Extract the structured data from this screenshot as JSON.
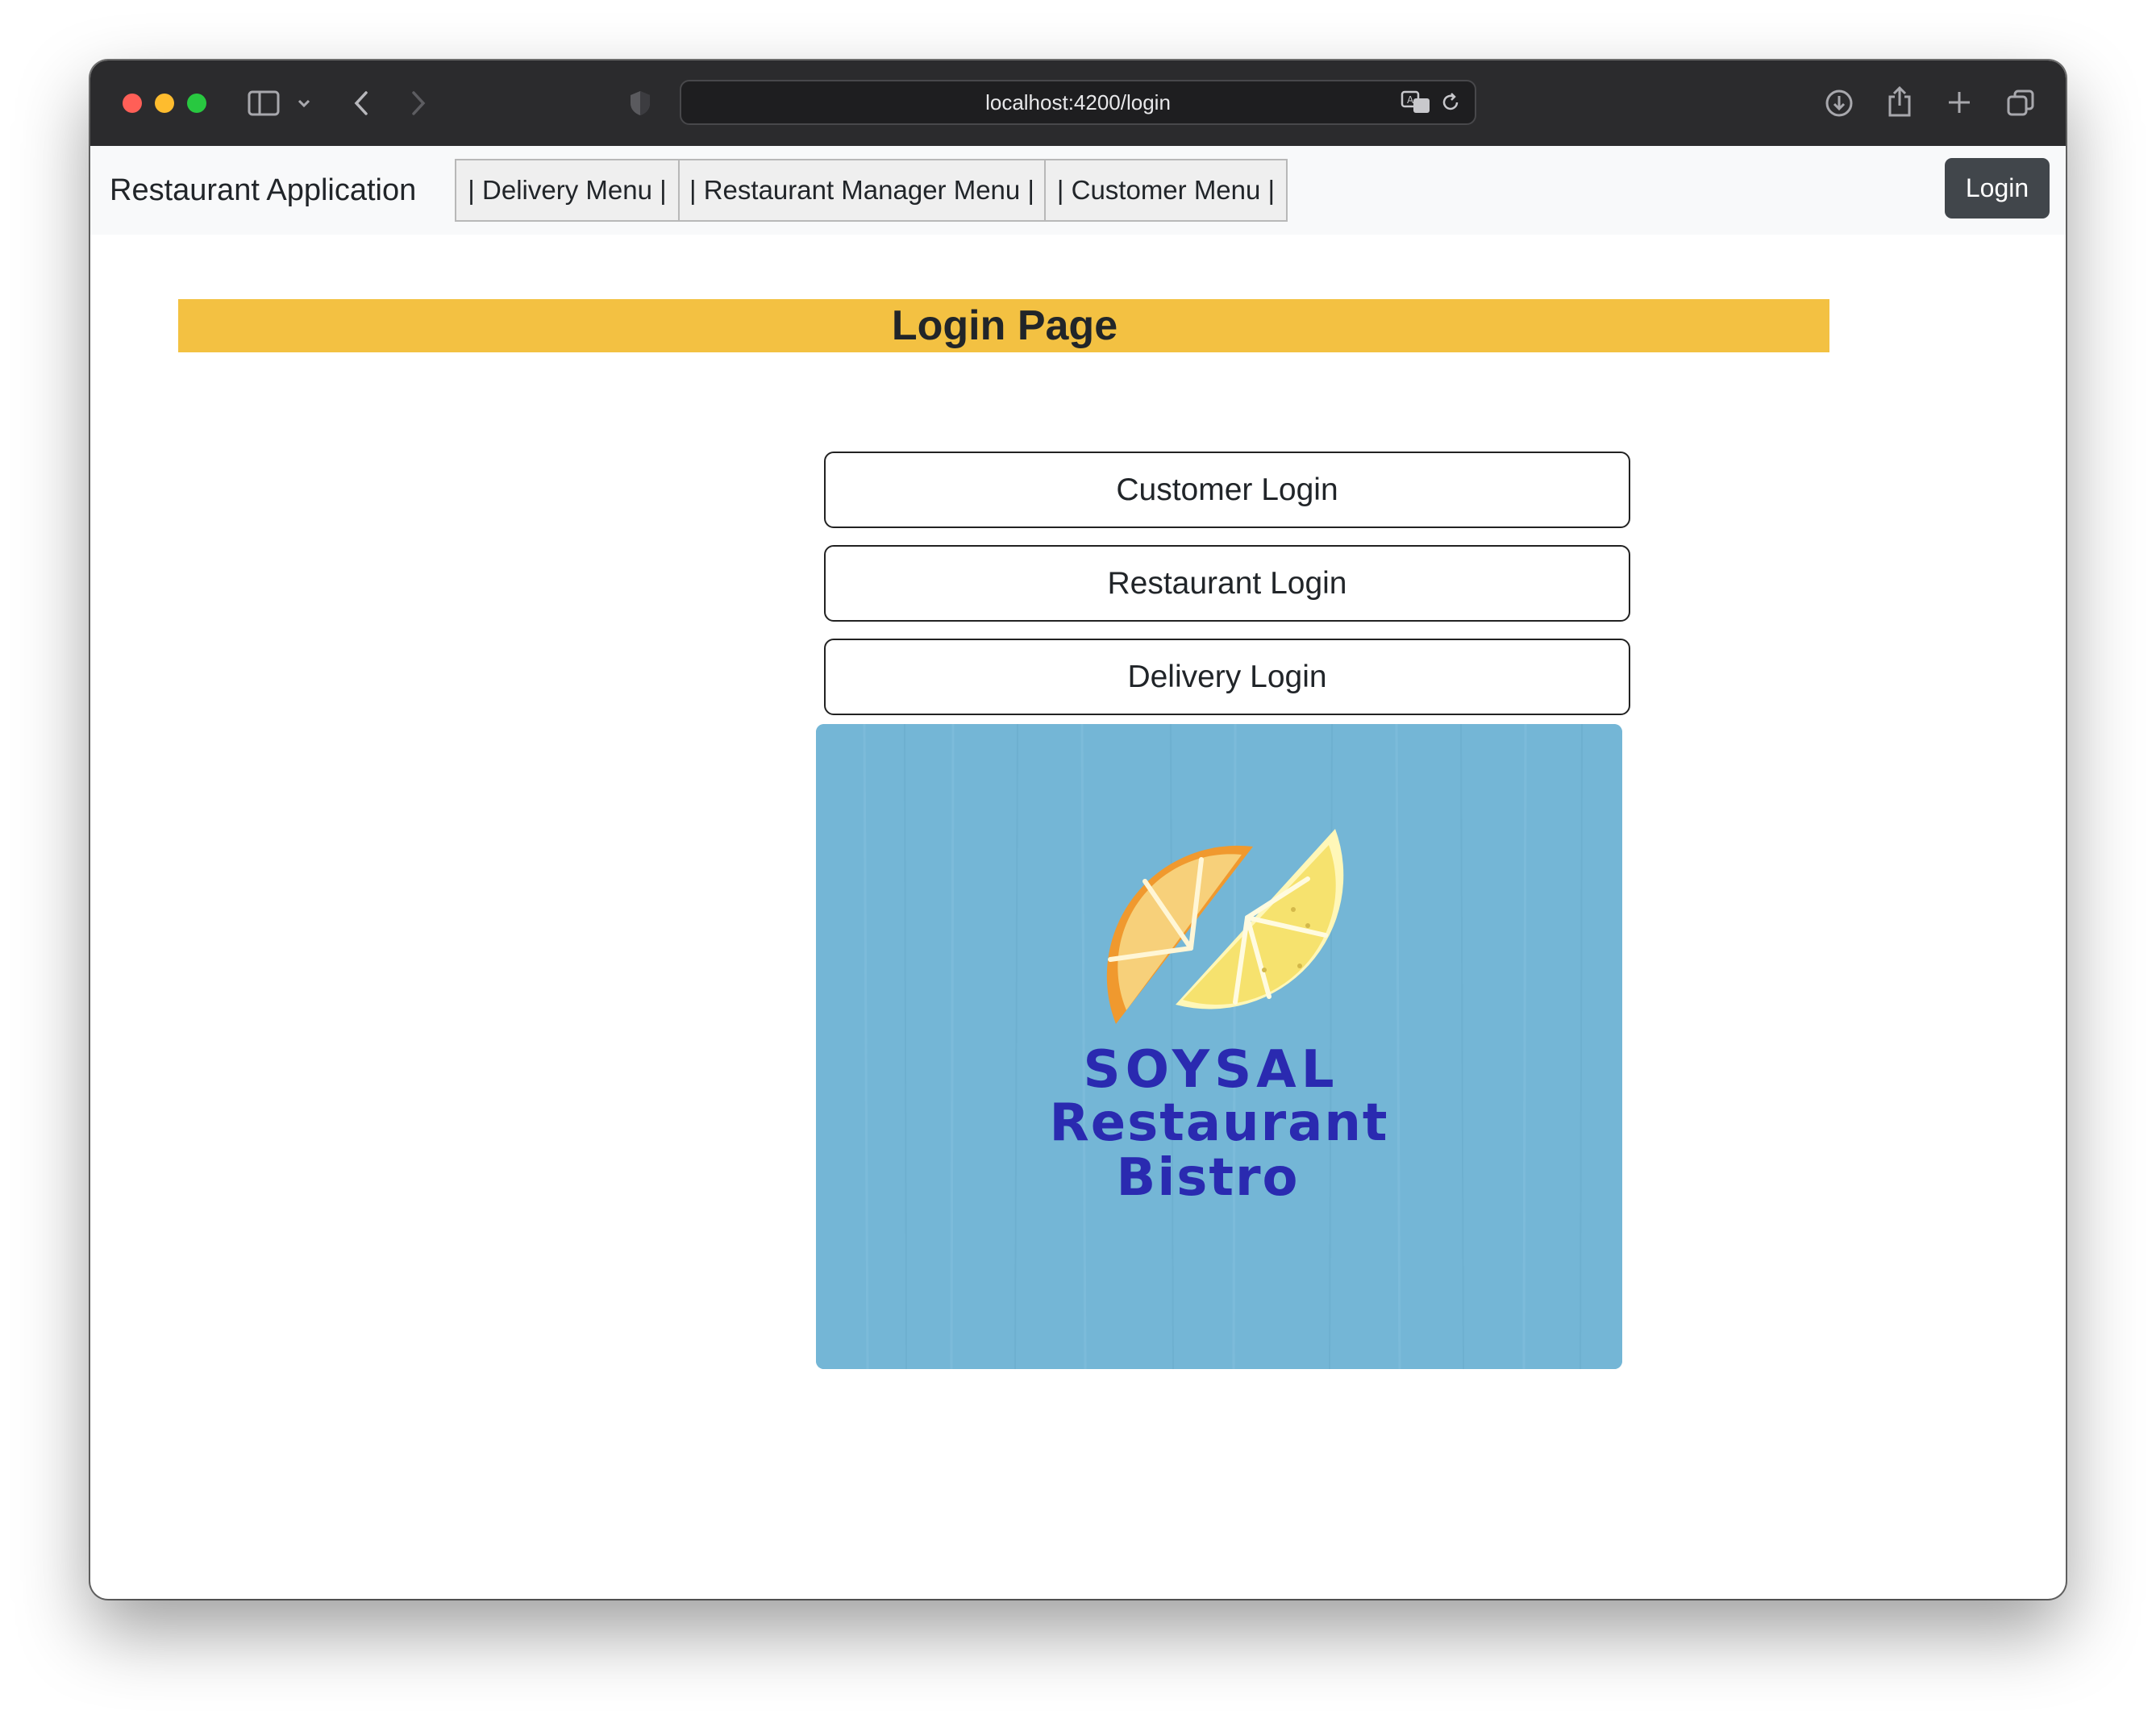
{
  "browser": {
    "url": "localhost:4200/login"
  },
  "navbar": {
    "brand": "Restaurant Application",
    "links": [
      {
        "label": "| Delivery Menu |"
      },
      {
        "label": "| Restaurant Manager Menu |"
      },
      {
        "label": "| Customer Menu |"
      }
    ],
    "login_label": "Login"
  },
  "page": {
    "title": "Login Page",
    "header_color": "#f3c142",
    "buttons": [
      {
        "label": "Customer Login"
      },
      {
        "label": "Restaurant Login"
      },
      {
        "label": "Delivery Login"
      }
    ]
  },
  "logo": {
    "line1": "SOYSAL",
    "line2": "Restaurant",
    "line3": "Bistro",
    "background_color": "#74b6d6",
    "text_color": "#2a2ab0",
    "icon": "citrus-slices-icon"
  }
}
